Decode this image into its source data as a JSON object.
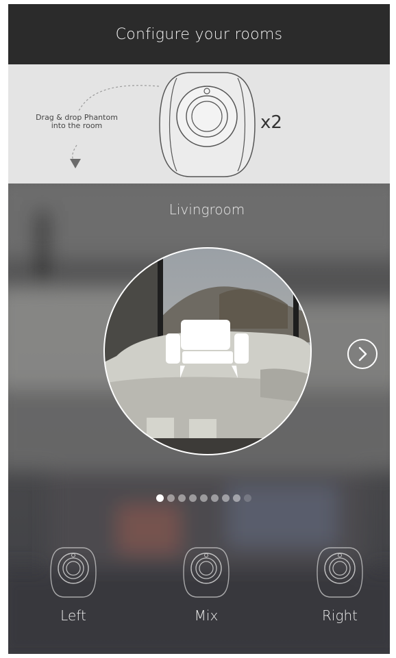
{
  "header": {
    "title": "Configure your rooms"
  },
  "drag_panel": {
    "hint_line1": "Drag & drop Phantom",
    "hint_line2": "into the room",
    "count": "x2",
    "arrow_icon": "dashed-curve-arrow-icon",
    "device_icon": "phantom-speaker-icon"
  },
  "room": {
    "name": "Livingroom",
    "icon": "armchair-icon",
    "next_icon": "chevron-right-icon"
  },
  "pager": {
    "total": 9,
    "active": 1
  },
  "slots": {
    "left": "Left",
    "mix": "Mix",
    "right": "Right"
  },
  "colors": {
    "header_bg": "#2b2b2b",
    "panel_bg": "#e4e4e4",
    "text_light": "#ffffff",
    "text_dark": "#333333"
  }
}
